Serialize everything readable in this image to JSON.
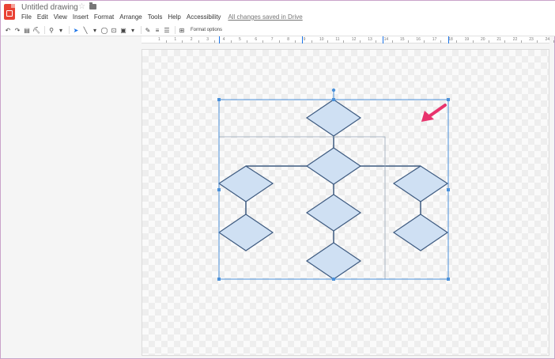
{
  "app": {
    "title": "Untitled drawing",
    "saved_status": "All changes saved in Drive",
    "star_icon": "star-icon",
    "folder_icon": "folder-icon"
  },
  "menu": [
    "File",
    "Edit",
    "View",
    "Insert",
    "Format",
    "Arrange",
    "Tools",
    "Help",
    "Accessibility"
  ],
  "toolbar": {
    "format_options": "Format options",
    "icons": [
      "undo-icon",
      "redo-icon",
      "print-icon",
      "paint-format-icon",
      "zoom-icon",
      "select-icon",
      "line-icon",
      "shape-icon",
      "text-box-icon",
      "image-icon",
      "line-color-icon",
      "line-weight-icon",
      "line-dash-icon",
      "add-comment-icon"
    ]
  },
  "ruler": {
    "labels": [
      "1",
      "1",
      "2",
      "3",
      "4",
      "5",
      "6",
      "7",
      "8",
      "9",
      "10",
      "11",
      "12",
      "13",
      "14",
      "15",
      "16",
      "17",
      "18",
      "19",
      "20",
      "21",
      "22",
      "23",
      "24",
      "25"
    ]
  },
  "colors": {
    "diamond_fill": "#cfe0f3",
    "diamond_stroke": "#3d5a80",
    "connector": "#3d5a80",
    "selection": "#4a90d9",
    "arrow": "#e8336d"
  },
  "diagram": {
    "shapes": [
      "diamond-top",
      "diamond-level2",
      "diamond-left-1",
      "diamond-center-2",
      "diamond-right-1",
      "diamond-left-2",
      "diamond-right-2",
      "diamond-center-3"
    ],
    "annotation": "arrow-pointer"
  }
}
